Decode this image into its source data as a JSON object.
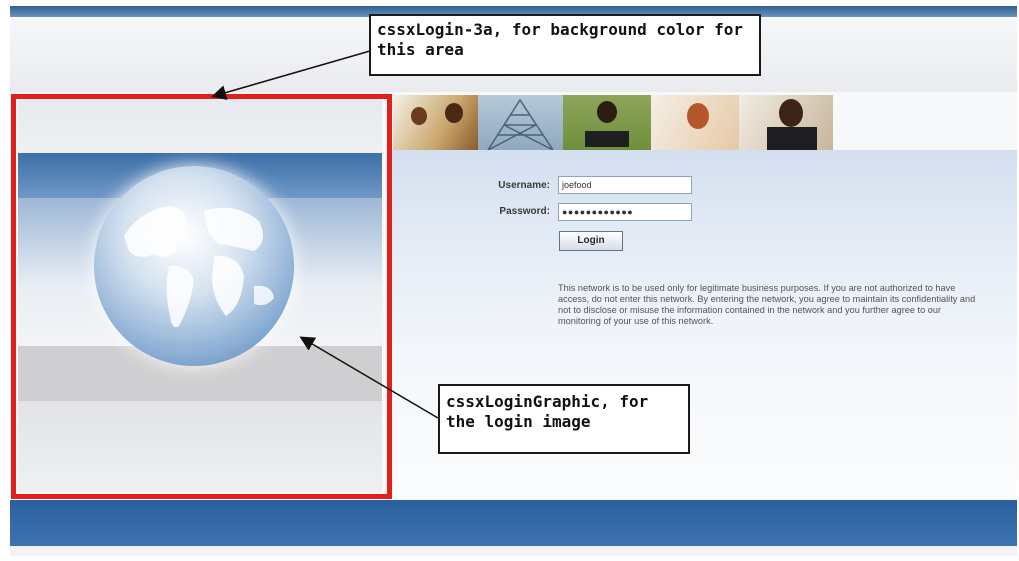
{
  "login": {
    "username_label": "Username:",
    "username_value": "joefood",
    "password_label": "Password:",
    "password_value": "●●●●●●●●●●●●",
    "button_label": "Login"
  },
  "disclaimer": "This network is to be used only for legitimate business purposes. If you are not authorized to have access, do not enter this network. By entering the network, you agree to maintain its confidentiality and not to disclose or misuse the information contained in the network and you further agree to our monitoring of your use of this network.",
  "annotations": {
    "background_callout": "cssxLogin-3a, for background color for this area",
    "graphic_callout": "cssxLoginGraphic, for the login image"
  },
  "colors": {
    "highlight_frame": "#e0201b",
    "header_bar": "#2d5f94",
    "footer_bar": "#2a5f9d"
  }
}
